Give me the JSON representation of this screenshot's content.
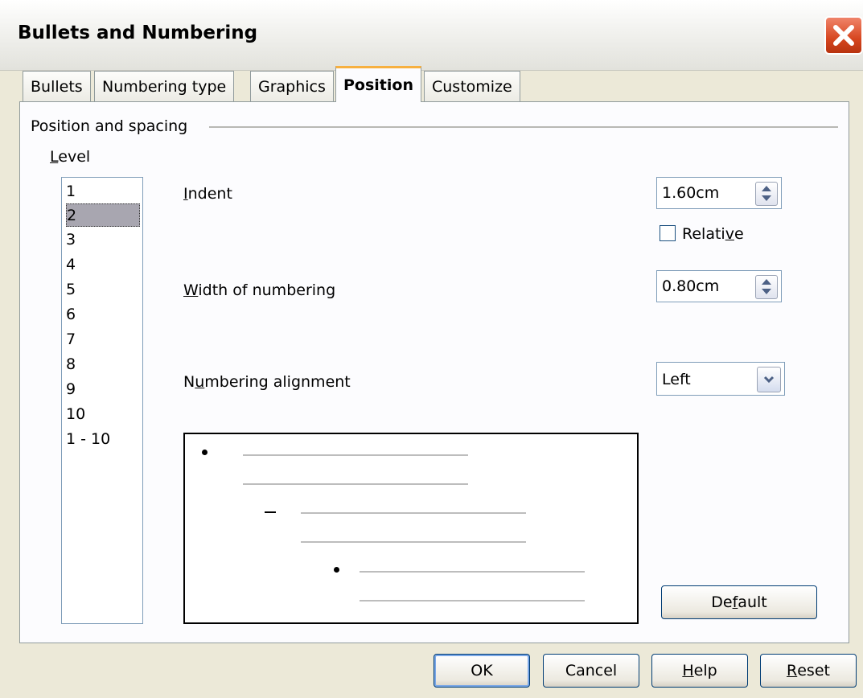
{
  "window": {
    "title": "Bullets and Numbering"
  },
  "tabs": [
    {
      "label": "Bullets"
    },
    {
      "label": "Numbering type"
    },
    {
      "label": "Graphics"
    },
    {
      "label": "Position",
      "active": true
    },
    {
      "label": "Customize"
    }
  ],
  "position_spacing": {
    "group_label": "Position and spacing",
    "level": {
      "label_first": "L",
      "label_rest": "evel",
      "items": [
        "1",
        "2",
        "3",
        "4",
        "5",
        "6",
        "7",
        "8",
        "9",
        "10",
        "1 - 10"
      ],
      "selected": "2"
    },
    "indent": {
      "label_first": "I",
      "label_rest": "ndent",
      "value": "1.60cm"
    },
    "relative": {
      "label_a": "Relati",
      "label_u": "v",
      "label_b": "e",
      "checked": false
    },
    "width": {
      "label_first": "W",
      "label_rest": "idth of numbering",
      "value": "0.80cm"
    },
    "alignment": {
      "label_a": "N",
      "label_u": "u",
      "label_b": "mbering alignment",
      "value": "Left"
    }
  },
  "buttons": {
    "default": {
      "a": "De",
      "u": "f",
      "b": "ault"
    },
    "ok": "OK",
    "cancel": "Cancel",
    "help": {
      "u": "H",
      "b": "elp"
    },
    "reset": {
      "u": "R",
      "b": "eset"
    }
  },
  "icons": {
    "close": "close-x-icon",
    "spin": "spin-arrows-icon",
    "dropdown": "chevron-down-icon"
  },
  "colors": {
    "dialog_bg": "#ece9d8",
    "page_bg": "#fcfcfe",
    "active_tab_accent": "#f7b03f",
    "close_button": "#d6461f",
    "selection_bg": "#a8a6b0"
  }
}
